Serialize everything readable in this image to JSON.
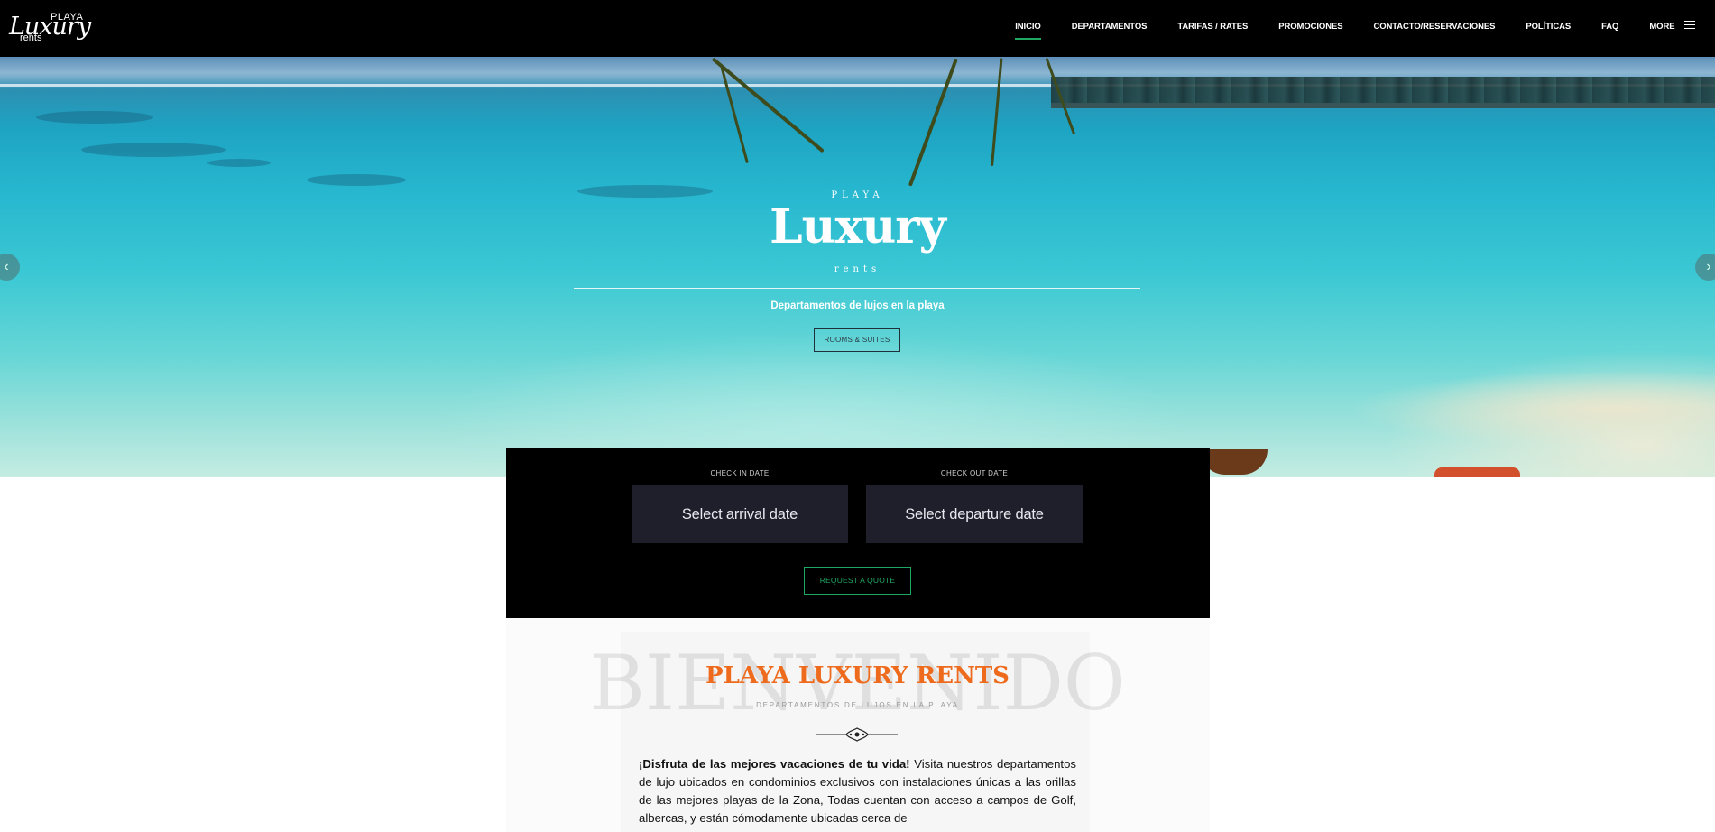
{
  "brand": {
    "logo_top": "PLAYA",
    "logo_main": "Luxury",
    "logo_bottom": "rents"
  },
  "nav": {
    "items": [
      {
        "label": "INICIO",
        "active": true
      },
      {
        "label": "DEPARTAMENTOS",
        "active": false
      },
      {
        "label": "TARIFAS / RATES",
        "active": false
      },
      {
        "label": "PROMOCIONES",
        "active": false
      },
      {
        "label": "CONTACTO/RESERVACIONES",
        "active": false
      },
      {
        "label": "POLÍTICAS",
        "active": false
      },
      {
        "label": "FAQ",
        "active": false
      },
      {
        "label": "MORE",
        "active": false
      }
    ],
    "more_icon": "hamburger-icon",
    "active_color": "#1fa862"
  },
  "hero": {
    "playa": "PLAYA",
    "title": "Luxury",
    "rents": "rents",
    "subtitle": "Departamentos de lujos en la playa",
    "button_label": "ROOMS & SUITES",
    "prev_icon": "chevron-left-icon",
    "next_icon": "chevron-right-icon"
  },
  "booking": {
    "checkin_label": "CHECK IN DATE",
    "checkin_placeholder": "Select arrival date",
    "checkout_label": "CHECK OUT DATE",
    "checkout_placeholder": "Select departure date",
    "quote_label": "REQUEST A QUOTE",
    "accent": "#1fa862"
  },
  "welcome": {
    "background_word": "BIENVENIDO",
    "title": "PLAYA LUXURY RENTS",
    "subtitle": "DEPARTAMENTOS DE LUJOS EN LA PLAYA",
    "title_color": "#ee6b1d",
    "intro_bold": "¡Disfruta de las mejores vacaciones de tu vida!",
    "intro_text": " Visita nuestros departamentos de lujo ubicados en condominios exclusivos con instalaciones únicas a las orillas de las mejores playas de la Zona, Todas cuentan con acceso a campos de Golf, albercas, y están cómodamente ubicadas cerca de"
  }
}
